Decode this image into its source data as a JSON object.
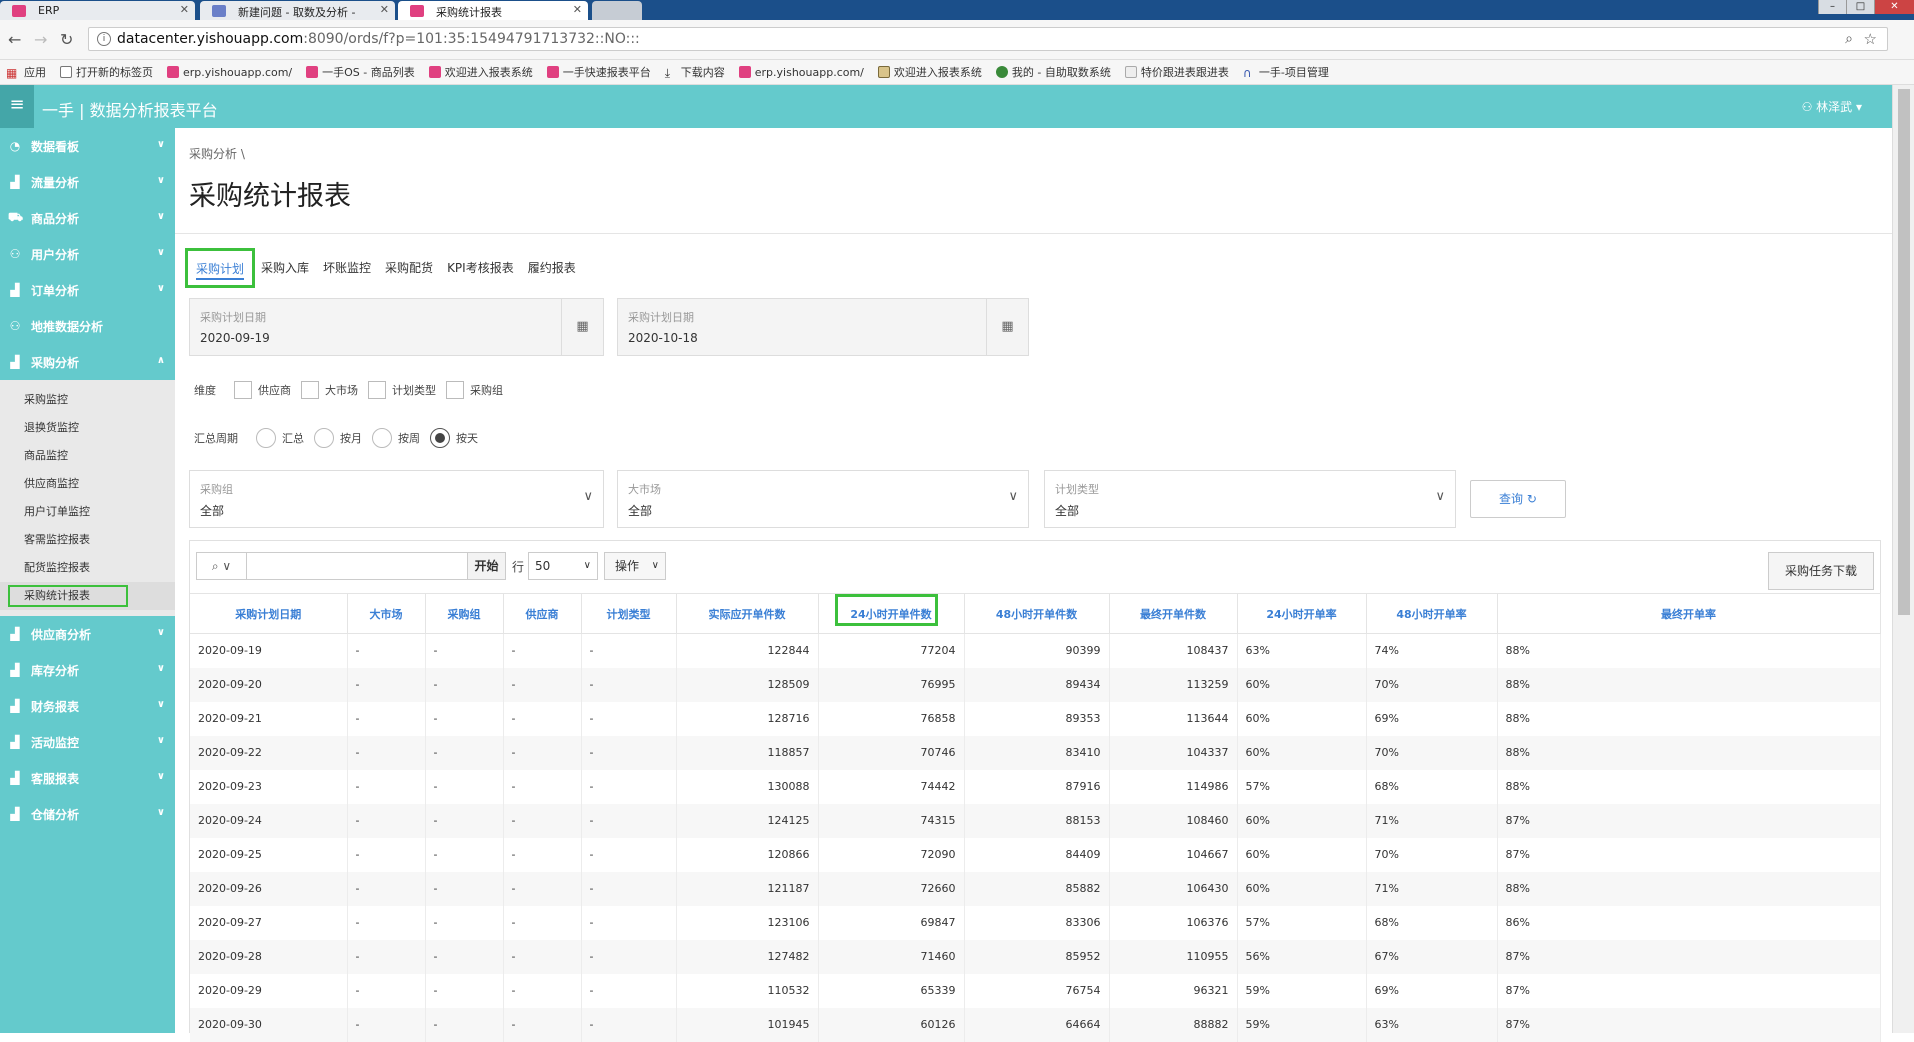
{
  "browser": {
    "tabs": [
      {
        "title": "ERP",
        "active": false
      },
      {
        "title": "新建问题 - 取数及分析 -",
        "active": false
      },
      {
        "title": "采购统计报表",
        "active": true
      }
    ],
    "url_host": "datacenter.yishouapp.com",
    "url_rest": ":8090/ords/f?p=101:35:15494791713732::NO:::",
    "bookmarks": [
      "应用",
      "打开新的标签页",
      "erp.yishouapp.com/",
      "一手OS - 商品列表",
      "欢迎进入报表系统",
      "一手快速报表平台",
      "下载内容",
      "erp.yishouapp.com/",
      "欢迎进入报表系统",
      "我的 - 自助取数系统",
      "特价跟进表跟进表",
      "一手-项目管理"
    ]
  },
  "app": {
    "title": "一手 | 数据分析报表平台",
    "user": "林泽武"
  },
  "sidebar": {
    "items_top": [
      "数据看板",
      "流量分析",
      "商品分析",
      "用户分析",
      "订单分析",
      "地推数据分析",
      "采购分析"
    ],
    "submenu": [
      "采购监控",
      "退换货监控",
      "商品监控",
      "供应商监控",
      "用户订单监控",
      "客需监控报表",
      "配货监控报表",
      "采购统计报表"
    ],
    "items_bottom": [
      "供应商分析",
      "库存分析",
      "财务报表",
      "活动监控",
      "客服报表",
      "仓储分析"
    ]
  },
  "main": {
    "breadcrumb": "采购分析",
    "title": "采购统计报表",
    "tabs": [
      "采购计划",
      "采购入库",
      "坏账监控",
      "采购配货",
      "KPI考核报表",
      "履约报表"
    ],
    "date_from": {
      "label": "采购计划日期",
      "value": "2020-09-19"
    },
    "date_to": {
      "label": "采购计划日期",
      "value": "2020-10-18"
    },
    "dimension": {
      "label": "维度",
      "options": [
        "供应商",
        "大市场",
        "计划类型",
        "采购组"
      ]
    },
    "period": {
      "label": "汇总周期",
      "options": [
        "汇总",
        "按月",
        "按周",
        "按天"
      ],
      "selected": "按天"
    },
    "filters": [
      {
        "label": "采购组",
        "value": "全部"
      },
      {
        "label": "大市场",
        "value": "全部"
      },
      {
        "label": "计划类型",
        "value": "全部"
      }
    ],
    "query_label": "查询"
  },
  "report": {
    "search_go": "开始",
    "rows_label": "行",
    "rows_value": "50",
    "ops_label": "操作",
    "download_label": "采购任务下载",
    "columns": [
      "采购计划日期",
      "大市场",
      "采购组",
      "供应商",
      "计划类型",
      "实际应开单件数",
      "24小时开单件数",
      "48小时开单件数",
      "最终开单件数",
      "24小时开单率",
      "48小时开单率",
      "最终开单率"
    ],
    "rows": [
      [
        "2020-09-19",
        "-",
        "-",
        "-",
        "-",
        "122844",
        "77204",
        "90399",
        "108437",
        "63%",
        "74%",
        "88%"
      ],
      [
        "2020-09-20",
        "-",
        "-",
        "-",
        "-",
        "128509",
        "76995",
        "89434",
        "113259",
        "60%",
        "70%",
        "88%"
      ],
      [
        "2020-09-21",
        "-",
        "-",
        "-",
        "-",
        "128716",
        "76858",
        "89353",
        "113644",
        "60%",
        "69%",
        "88%"
      ],
      [
        "2020-09-22",
        "-",
        "-",
        "-",
        "-",
        "118857",
        "70746",
        "83410",
        "104337",
        "60%",
        "70%",
        "88%"
      ],
      [
        "2020-09-23",
        "-",
        "-",
        "-",
        "-",
        "130088",
        "74442",
        "87916",
        "114986",
        "57%",
        "68%",
        "88%"
      ],
      [
        "2020-09-24",
        "-",
        "-",
        "-",
        "-",
        "124125",
        "74315",
        "88153",
        "108460",
        "60%",
        "71%",
        "87%"
      ],
      [
        "2020-09-25",
        "-",
        "-",
        "-",
        "-",
        "120866",
        "72090",
        "84409",
        "104667",
        "60%",
        "70%",
        "87%"
      ],
      [
        "2020-09-26",
        "-",
        "-",
        "-",
        "-",
        "121187",
        "72660",
        "85882",
        "106430",
        "60%",
        "71%",
        "88%"
      ],
      [
        "2020-09-27",
        "-",
        "-",
        "-",
        "-",
        "123106",
        "69847",
        "83306",
        "106376",
        "57%",
        "68%",
        "86%"
      ],
      [
        "2020-09-28",
        "-",
        "-",
        "-",
        "-",
        "127482",
        "71460",
        "85952",
        "110955",
        "56%",
        "67%",
        "87%"
      ],
      [
        "2020-09-29",
        "-",
        "-",
        "-",
        "-",
        "110532",
        "65339",
        "76754",
        "96321",
        "59%",
        "69%",
        "87%"
      ],
      [
        "2020-09-30",
        "-",
        "-",
        "-",
        "-",
        "101945",
        "60126",
        "64664",
        "88882",
        "59%",
        "63%",
        "87%"
      ]
    ]
  }
}
